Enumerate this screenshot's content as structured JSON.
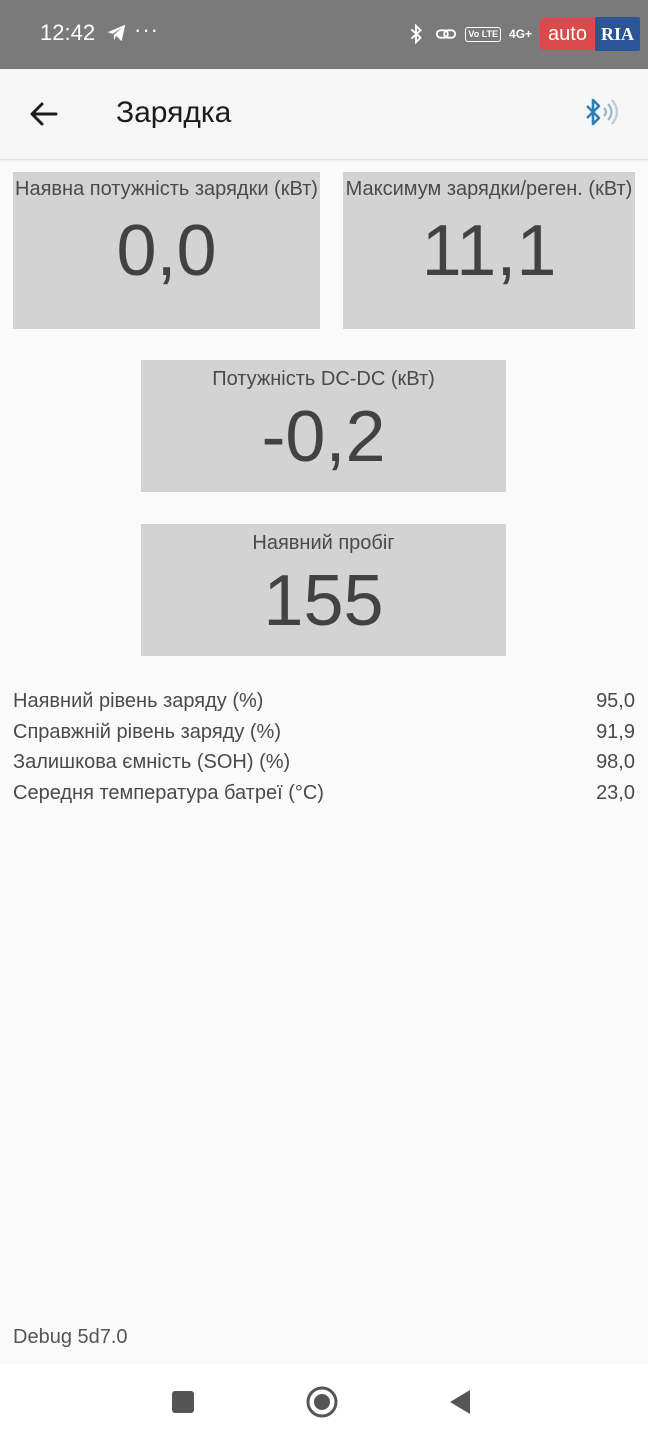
{
  "status_bar": {
    "time": "12:42",
    "more": "···",
    "volte": "Vo LTE",
    "network": "4G+",
    "watermark_left": "auto",
    "watermark_right": "RIA",
    "icons": [
      "telegram-icon",
      "bluetooth-icon",
      "link-icon",
      "volte-icon",
      "signal-icon"
    ]
  },
  "app_bar": {
    "title": "Зарядка",
    "icons": [
      "back-arrow-icon",
      "bluetooth-connected-icon"
    ],
    "accent_color": "#2f7fb6"
  },
  "tiles": [
    {
      "label": "Наявна потужність зарядки (кВт)",
      "value": "0,0"
    },
    {
      "label": "Максимум зарядки/реген. (кВт)",
      "value": "11,1"
    },
    {
      "label": "Потужність DC-DC (кВт)",
      "value": "-0,2"
    },
    {
      "label": "Наявний пробіг",
      "value": "155"
    }
  ],
  "stats": [
    {
      "label": "Наявний рівень заряду (%)",
      "value": "95,0"
    },
    {
      "label": "Справжній рівень заряду (%)",
      "value": "91,9"
    },
    {
      "label": "Залишкова ємність (SOH) (%)",
      "value": "98,0"
    },
    {
      "label": "Середня температура батреї (°C)",
      "value": "23,0"
    }
  ],
  "debug": "Debug 5d7.0",
  "nav_bar": {
    "icons": [
      "recents-square-icon",
      "home-circle-icon",
      "back-triangle-icon"
    ]
  },
  "colors": {
    "tile_bg": "#d3d3d3",
    "status_bar_bg": "#7a7a7a",
    "page_bg": "#fafafa"
  }
}
